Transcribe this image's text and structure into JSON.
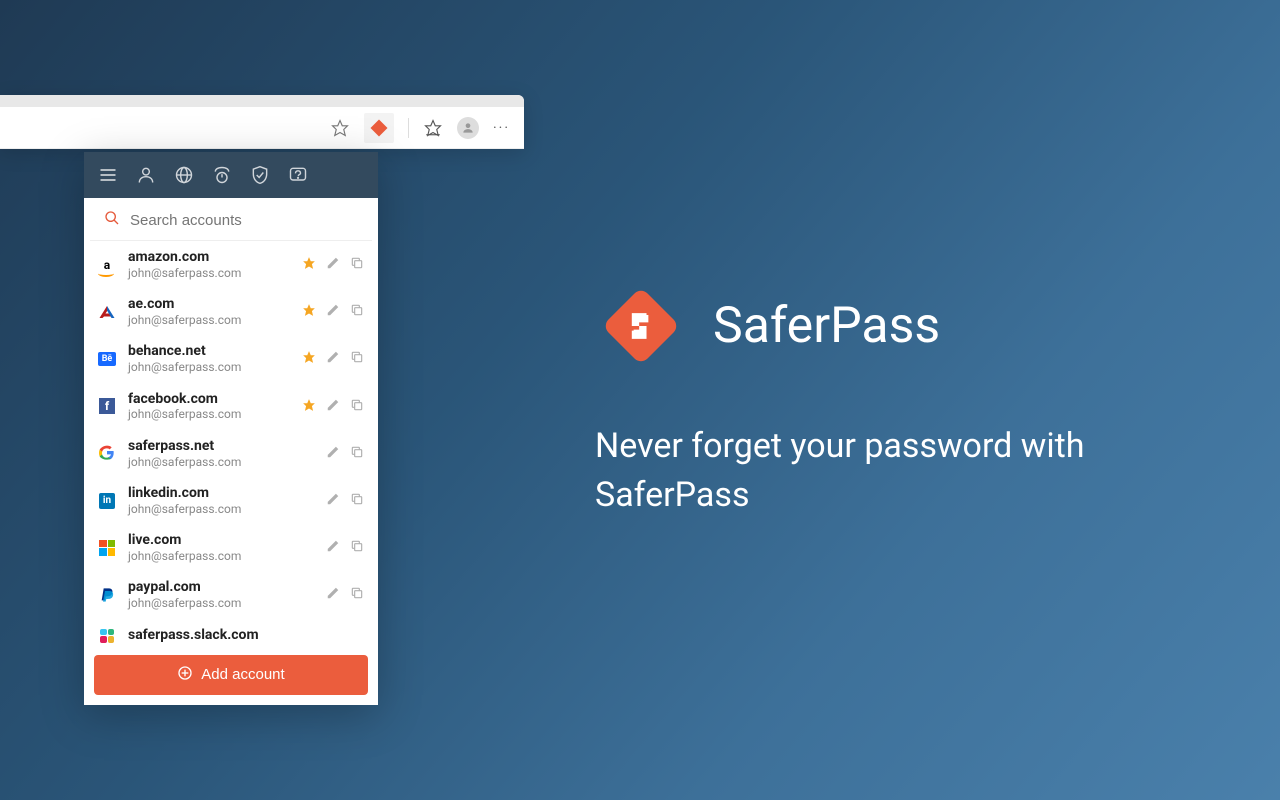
{
  "brand": {
    "name": "SaferPass"
  },
  "tagline": "Never forget your password with SaferPass",
  "search": {
    "placeholder": "Search accounts"
  },
  "add_button_label": "Add account",
  "accounts": [
    {
      "domain": "amazon.com",
      "email": "john@saferpass.com",
      "starred": true
    },
    {
      "domain": "ae.com",
      "email": "john@saferpass.com",
      "starred": true
    },
    {
      "domain": "behance.net",
      "email": "john@saferpass.com",
      "starred": true
    },
    {
      "domain": "facebook.com",
      "email": "john@saferpass.com",
      "starred": true
    },
    {
      "domain": "saferpass.net",
      "email": "john@saferpass.com",
      "starred": false
    },
    {
      "domain": "linkedin.com",
      "email": "john@saferpass.com",
      "starred": false
    },
    {
      "domain": "live.com",
      "email": "john@saferpass.com",
      "starred": false
    },
    {
      "domain": "paypal.com",
      "email": "john@saferpass.com",
      "starred": false
    },
    {
      "domain": "saferpass.slack.com",
      "email": "",
      "starred": false
    }
  ]
}
